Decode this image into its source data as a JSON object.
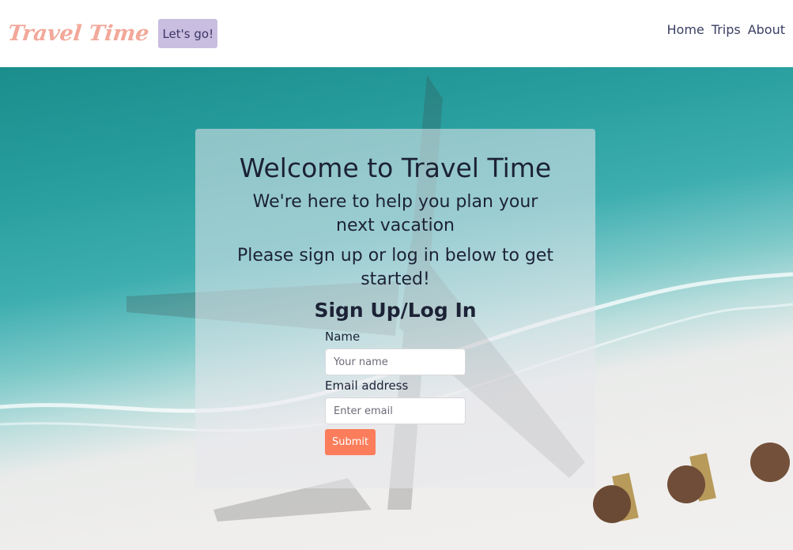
{
  "navbar": {
    "brand": "Travel Time",
    "cta_label": "Let's go!",
    "links": [
      "Home",
      "Trips",
      "About"
    ]
  },
  "welcome": {
    "title": "Welcome to Travel Time",
    "subtitle_1": "We're here to help you plan your next vacation",
    "subtitle_2": "Please sign up or log in below to get started!"
  },
  "form": {
    "title": "Sign Up/Log In",
    "name_label": "Name",
    "name_placeholder": "Your name",
    "email_label": "Email address",
    "email_placeholder": "Enter email",
    "submit_label": "Submit"
  },
  "colors": {
    "brand": "#f2a89a",
    "cta_bg": "#c9bde0",
    "submit_bg": "#fb7d5b",
    "nav_text": "#3a3f63"
  },
  "background": {
    "description_icons": [
      "ocean-water",
      "beach-sand",
      "airplane-shadow",
      "beach-umbrella-icon",
      "sun-lounger-icon"
    ]
  }
}
